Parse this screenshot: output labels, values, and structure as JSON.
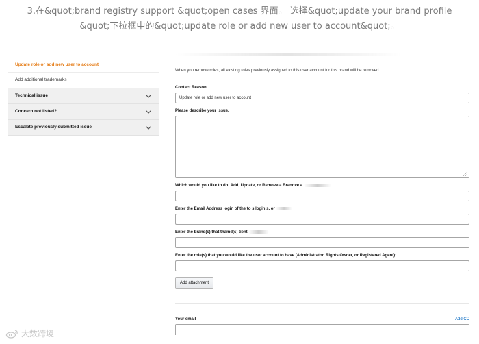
{
  "caption": {
    "line1": "3.在&quot;brand registry support &quot;open cases 界面。 选择&quot;update your brand profile",
    "line2": "&quot;下拉框中的&quot;update role or add new user to account&quot;。"
  },
  "sidebar": {
    "selected_item": "Update role or add new user to account",
    "sub_item": "Add additional trademarks",
    "accordions": [
      {
        "label": "Technical issue"
      },
      {
        "label": "Concern not listed?"
      },
      {
        "label": "Escalate previously submitted issue"
      }
    ]
  },
  "form": {
    "note": "When you remove roles, all existing roles previously assigned to this user account for this brand will be removed.",
    "contact_reason": {
      "label": "Contact Reason",
      "value": "Update role or add new user to account"
    },
    "describe": {
      "label": "Please describe your issue."
    },
    "q_action": {
      "label": "Which would you like to do: Add, Update, or Remove a Branove a"
    },
    "q_email": {
      "label": "Enter the Email Address login of the",
      "tail1": "to s login",
      "tail2": "s, or"
    },
    "q_brand": {
      "label": "Enter the brand(s) that thamd(s)",
      "tail": "tient"
    },
    "q_role": {
      "label": "Enter the role(s) that you would like the user account to have (Administrator, Rights Owner, or Registered Agent):"
    },
    "attach_button": "Add attachment",
    "your_email": {
      "label": "Your email",
      "add_cc": "Add CC"
    }
  },
  "watermark": {
    "text": "大数跨境"
  }
}
